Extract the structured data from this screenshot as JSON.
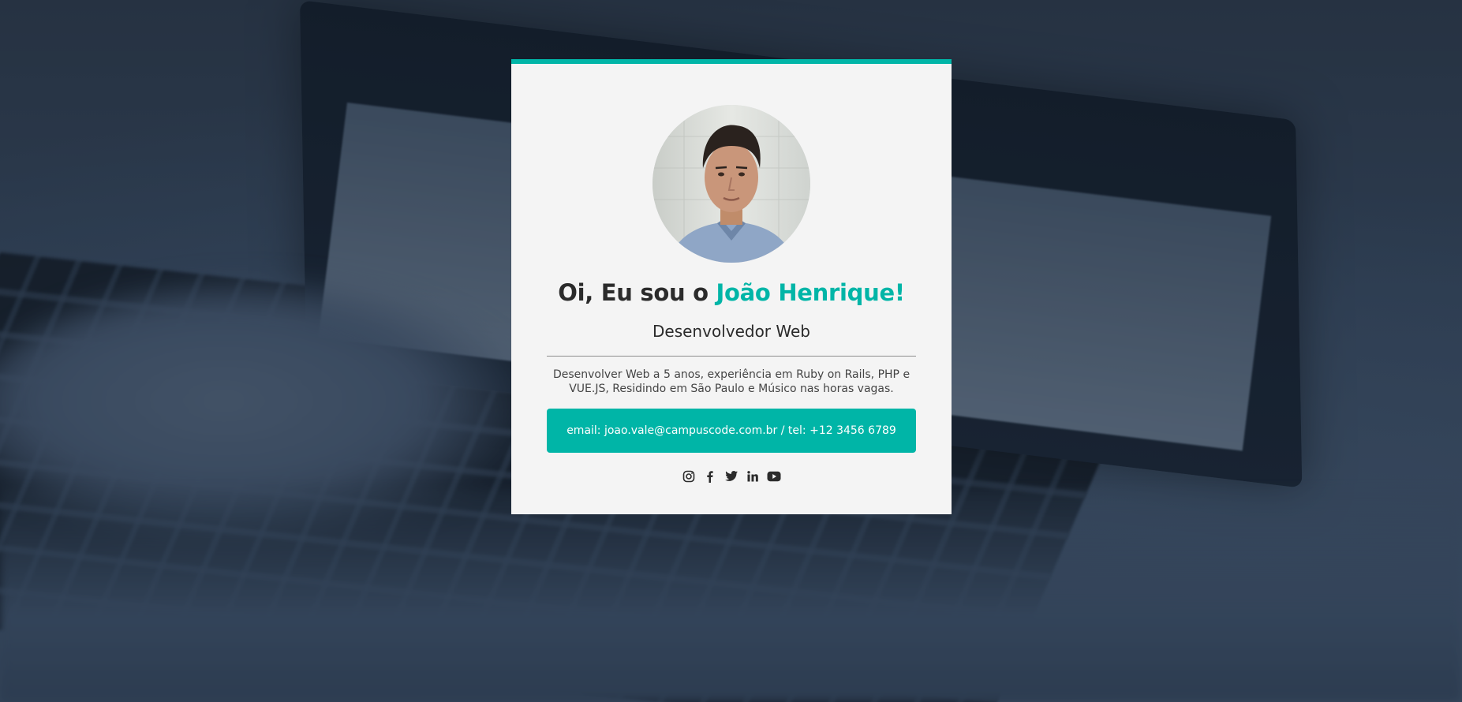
{
  "profile": {
    "greeting_prefix": "Oi, Eu sou o ",
    "name": "João Henrique!",
    "role": "Desenvolvedor Web",
    "bio": "Desenvolver Web a 5 anos, experiência em Ruby on Rails, PHP e VUE.JS, Residindo em São Paulo e Músico nas horas vagas.",
    "contact": "email: joao.vale@campuscode.com.br / tel: +12 3456 6789"
  },
  "social": [
    {
      "icon": "instagram-icon"
    },
    {
      "icon": "facebook-icon"
    },
    {
      "icon": "twitter-icon"
    },
    {
      "icon": "linkedin-icon"
    },
    {
      "icon": "youtube-icon"
    }
  ],
  "colors": {
    "accent": "#00b5a7",
    "card_background": "#f4f4f4",
    "text": "#2b2b2b",
    "page_background": "#2c3a4c"
  }
}
